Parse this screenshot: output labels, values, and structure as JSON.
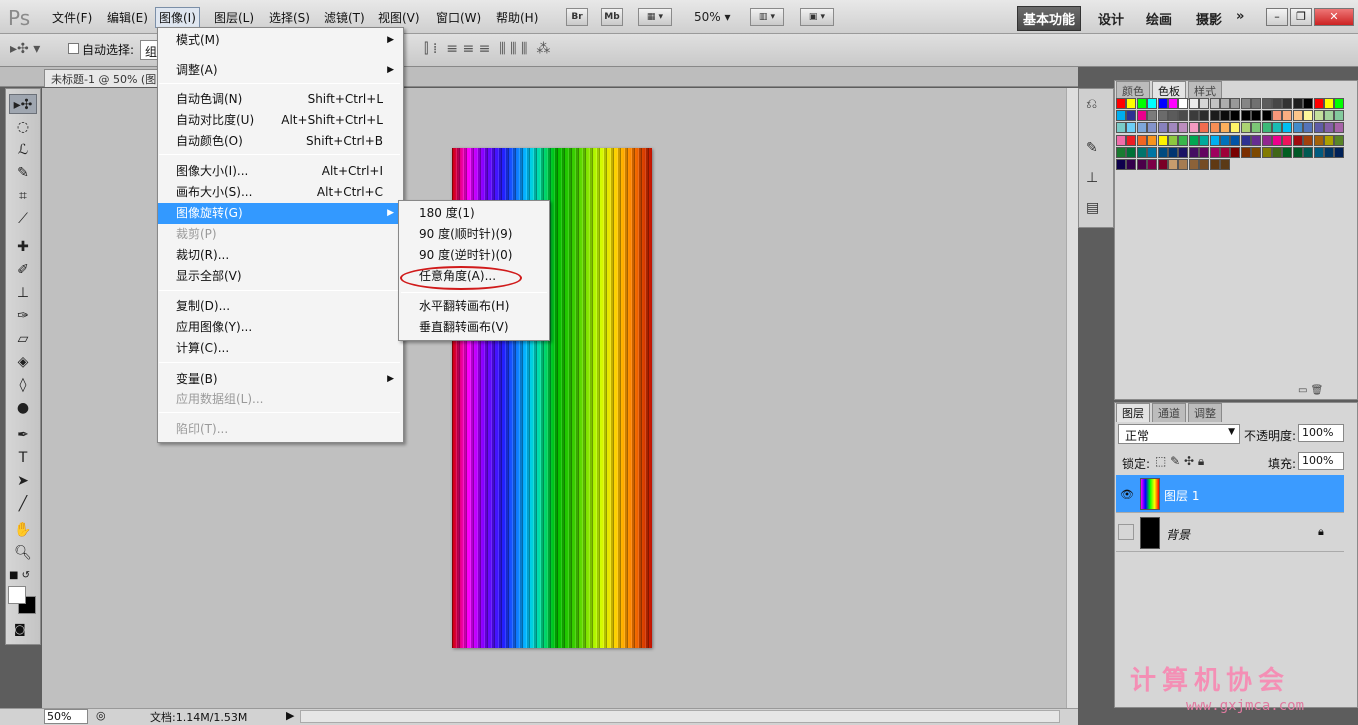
{
  "app": {
    "logo": "Ps"
  },
  "menubar": {
    "items": [
      "文件(F)",
      "编辑(E)",
      "图像(I)",
      "图层(L)",
      "选择(S)",
      "滤镜(T)",
      "视图(V)",
      "窗口(W)",
      "帮助(H)"
    ],
    "active": "图像(I)",
    "bridge_btn": "Br",
    "minibridge_btn": "Mb",
    "zoom": "50%",
    "workspaces": [
      "基本功能",
      "设计",
      "绘画",
      "摄影"
    ],
    "more": "»"
  },
  "options": {
    "auto_select_label": "自动选择:",
    "auto_select_value": "组"
  },
  "document": {
    "tab_title": "未标题-1 @ 50% (图"
  },
  "image_menu": {
    "items": [
      {
        "label": "模式(M)",
        "shortcut": "",
        "submenu": true,
        "disabled": false
      },
      {
        "label": "调整(A)",
        "shortcut": "",
        "submenu": true,
        "disabled": false
      },
      {
        "label": "自动色调(N)",
        "shortcut": "Shift+Ctrl+L",
        "submenu": false,
        "disabled": false
      },
      {
        "label": "自动对比度(U)",
        "shortcut": "Alt+Shift+Ctrl+L",
        "submenu": false,
        "disabled": false
      },
      {
        "label": "自动颜色(O)",
        "shortcut": "Shift+Ctrl+B",
        "submenu": false,
        "disabled": false
      },
      {
        "label": "图像大小(I)...",
        "shortcut": "Alt+Ctrl+I",
        "submenu": false,
        "disabled": false
      },
      {
        "label": "画布大小(S)...",
        "shortcut": "Alt+Ctrl+C",
        "submenu": false,
        "disabled": false
      },
      {
        "label": "图像旋转(G)",
        "shortcut": "",
        "submenu": true,
        "disabled": false,
        "highlighted": true
      },
      {
        "label": "裁剪(P)",
        "shortcut": "",
        "submenu": false,
        "disabled": true
      },
      {
        "label": "裁切(R)...",
        "shortcut": "",
        "submenu": false,
        "disabled": false
      },
      {
        "label": "显示全部(V)",
        "shortcut": "",
        "submenu": false,
        "disabled": false
      },
      {
        "label": "复制(D)...",
        "shortcut": "",
        "submenu": false,
        "disabled": false
      },
      {
        "label": "应用图像(Y)...",
        "shortcut": "",
        "submenu": false,
        "disabled": false
      },
      {
        "label": "计算(C)...",
        "shortcut": "",
        "submenu": false,
        "disabled": false
      },
      {
        "label": "变量(B)",
        "shortcut": "",
        "submenu": true,
        "disabled": false
      },
      {
        "label": "应用数据组(L)...",
        "shortcut": "",
        "submenu": false,
        "disabled": true
      },
      {
        "label": "陷印(T)...",
        "shortcut": "",
        "submenu": false,
        "disabled": true
      }
    ]
  },
  "rotate_submenu": {
    "items": [
      "180 度(1)",
      "90 度(顺时针)(9)",
      "90 度(逆时针)(0)",
      "任意角度(A)...",
      "水平翻转画布(H)",
      "垂直翻转画布(V)"
    ],
    "circled": "任意角度(A)..."
  },
  "swatch_panel": {
    "tabs": [
      "颜色",
      "色板",
      "样式"
    ],
    "active": "色板"
  },
  "layers_panel": {
    "tabs": [
      "图层",
      "通道",
      "调整"
    ],
    "active": "图层",
    "blend_mode": "正常",
    "opacity_label": "不透明度:",
    "opacity": "100%",
    "lock_label": "锁定:",
    "fill_label": "填充:",
    "fill": "100%",
    "layers": [
      {
        "name": "图层 1",
        "selected": true,
        "visible": true
      },
      {
        "name": "背景",
        "selected": false,
        "visible": false,
        "locked": true
      }
    ]
  },
  "status": {
    "zoom": "50%",
    "doc_info": "文档:1.14M/1.53M"
  },
  "watermark": {
    "text": "计算机协会",
    "url": "www.gxjmca.com"
  },
  "colors": {
    "highlight": "#3399ff",
    "circle": "#d01a1a",
    "layer_selected": "#3b9bff"
  }
}
